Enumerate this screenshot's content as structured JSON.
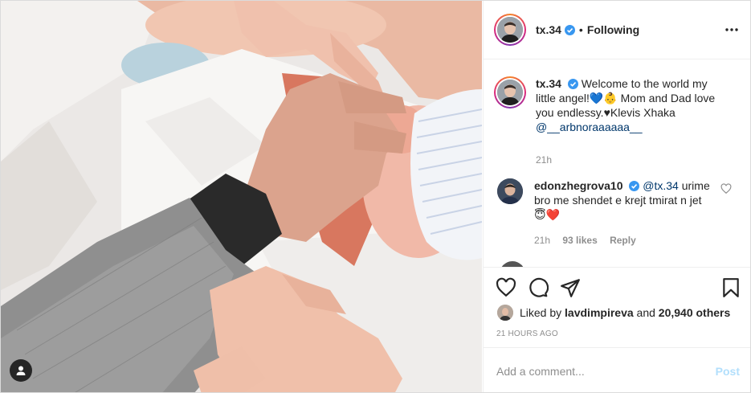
{
  "post": {
    "author": "tx.34",
    "author_verified": true,
    "header_separator": "•",
    "follow_status": "Following"
  },
  "caption": {
    "username": "tx.34",
    "text": "Welcome to the world my little angel!💙👶 Mom and Dad love you endlessy.♥Klevis Xhaka",
    "mention": "@__arbnoraaaaaa__",
    "time": "21h"
  },
  "comments": [
    {
      "username": "edonzhegrova10",
      "verified": true,
      "mention": "@tx.34",
      "text": "urime bro me shendet e krejt tmirat n jet 😇❤️",
      "time": "21h",
      "likes": "93 likes",
      "reply_label": "Reply"
    }
  ],
  "likes": {
    "prefix": "Liked by",
    "user": "lavdimpireva",
    "connector": "and",
    "count": "20,940 others"
  },
  "timestamp": "21 HOURS AGO",
  "add_comment": {
    "placeholder": "Add a comment...",
    "post_label": "Post"
  },
  "icons": {
    "more": "more-options-icon",
    "like": "heart-icon",
    "comment": "comment-icon",
    "share": "share-icon",
    "save": "bookmark-icon",
    "tagged": "user-tag-icon"
  },
  "colors": {
    "verified": "#3897f0",
    "link": "#00376b",
    "muted": "#8e8e8e",
    "post_disabled": "#b2dffc"
  }
}
